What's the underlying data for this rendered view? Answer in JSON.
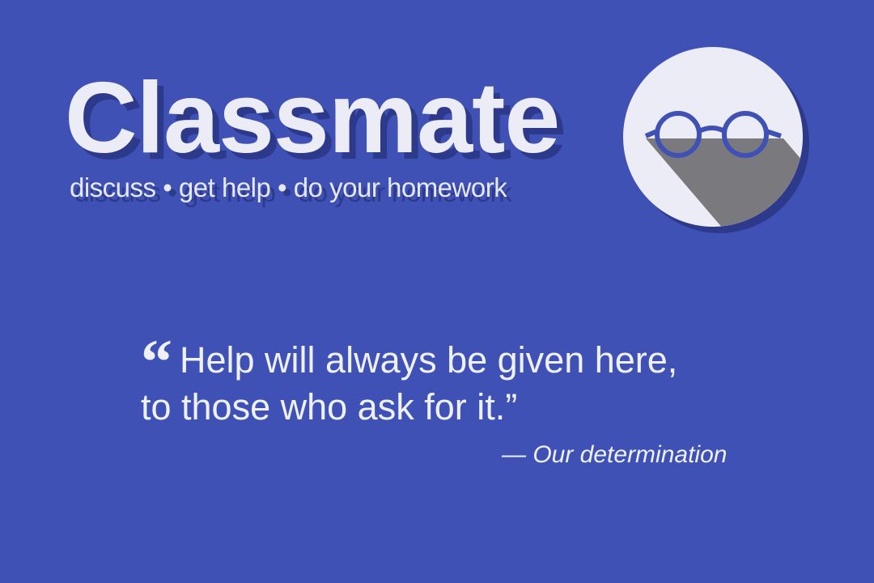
{
  "brand": {
    "title": "Classmate",
    "tagline": "discuss • get help • do your homework"
  },
  "logo": {
    "icon": "glasses-icon",
    "colors": {
      "circle": "#ececf6",
      "glasses": "#3f51b5",
      "shadow": "#7a7a7e",
      "badge_shadow": "#2d3a8c"
    }
  },
  "quote": {
    "open_mark": "“",
    "line1": "Help will always be given here,",
    "line2": "to those who ask for it.”",
    "attribution": "— Our determination"
  },
  "colors": {
    "background": "#3f51b5",
    "text": "#ececf6",
    "text_shadow": "#2d3a8c"
  }
}
